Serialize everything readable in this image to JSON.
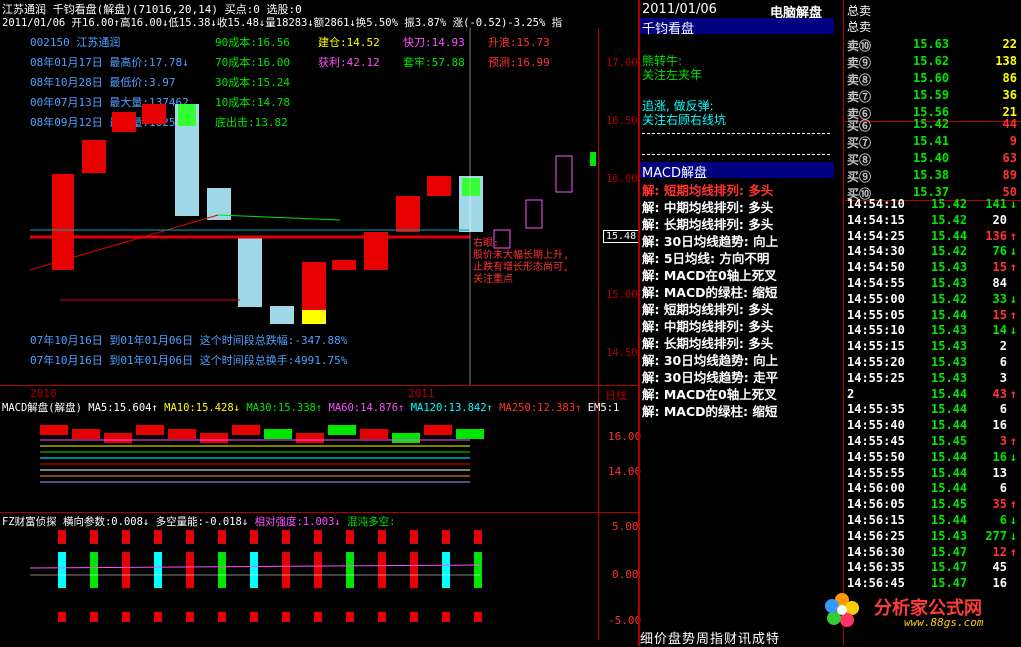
{
  "header": {
    "stock": "江苏通润",
    "title": "千钧看盘(解盘)(71016,20,14)",
    "buy": "买点:0",
    "pick": "选股:0",
    "quote": "2011/01/06 开16.00↑高16.00↓低15.38↓收15.48↓量18283↓额2861↓换5.50% 振3.87% 涨(-0.52)-3.25% 指"
  },
  "info_lines": [
    {
      "a": "002150 江苏通润",
      "b": "90成本:16.56",
      "c": "建仓:14.52",
      "d": "快刀:14.93",
      "e": "升浪:15.73"
    },
    {
      "a": "08年01月17日 最高价:17.78↓",
      "b": "70成本:16.00",
      "c": "获利:42.12",
      "d": "套牢:57.88",
      "e": "预测:16.99"
    },
    {
      "a": "08年10月28日 最低价:3.97",
      "b": "30成本:15.24"
    },
    {
      "a": "00年07月13日 最大量:137462",
      "b": "10成本:14.78"
    },
    {
      "a": "08年09月12日 最低量:1825",
      "b": "底出击:13.82"
    }
  ],
  "stats": [
    "07年10月16日 到01年01月06日 这个时间段总跌幅:-347.88%",
    "07年10月16日 到01年01月06日 这个时间段总换手:4991.75%"
  ],
  "annotation": [
    "右眼:",
    "股价未大幅长期上升,",
    "止跌有增长形态尚可,",
    "关注重点"
  ],
  "price_axis": [
    "17.00",
    "16.50",
    "16.00",
    "15.50",
    "15.00",
    "14.50"
  ],
  "current_price": "15.48",
  "date_axis": [
    "2010",
    "2011"
  ],
  "period": "日线",
  "macd_title": "MACD解盘(解盘)",
  "ma_labels": [
    "MA5:15.604↑",
    "MA10:15.428↓",
    "MA30:15.338↑",
    "MA60:14.876↑",
    "MA120:13.842↑",
    "MA250:12.383↑",
    "EM5:1"
  ],
  "macd_axis": [
    "16.00",
    "14.00"
  ],
  "fz_title": "FZ财富侦探",
  "fz_params": [
    "横向参数:0.008↓",
    "多空量能:-0.018↓",
    "相对强度:1.003↓",
    "混沌多空:"
  ],
  "fz_axis": [
    "5.00",
    "0.00",
    "-5.00"
  ],
  "panel": {
    "date": "2011/01/06",
    "title": "电脑解盘",
    "kanpan": "千钧看盘",
    "bull": "熊转牛:",
    "bull_tip": "关注左夹年",
    "chase": "追涨, 做反弹:",
    "chase_tip": "关注右顾右线坑",
    "macd": "MACD解盘",
    "items": [
      "解: 短期均线排列: 多头",
      "解: 中期均线排列: 多头",
      "解: 长期均线排列: 多头",
      "解: 30日均线趋势: 向上",
      "解: 5日均线: 方向不明",
      "解: MACD在0轴上死叉",
      "解: MACD的绿柱: 缩短",
      "解: 短期均线排列: 多头",
      "解: 中期均线排列: 多头",
      "解: 长期均线排列: 多头",
      "解: 30日均线趋势: 向上",
      "解: 30日均线趋势: 走平",
      "解: MACD在0轴上死叉",
      "解: MACD的绿柱: 缩短"
    ],
    "tabs": "细价盘势周指财讯成特"
  },
  "orders": {
    "total": "总卖",
    "sells": [
      [
        "卖⑩",
        "15.63",
        "22"
      ],
      [
        "卖⑨",
        "15.62",
        "138"
      ],
      [
        "卖⑧",
        "15.60",
        "86"
      ],
      [
        "卖⑦",
        "15.59",
        "36"
      ],
      [
        "卖⑥",
        "15.56",
        "21"
      ]
    ],
    "buys": [
      [
        "买⑥",
        "15.42",
        "44"
      ],
      [
        "买⑦",
        "15.41",
        "9"
      ],
      [
        "买⑧",
        "15.40",
        "63"
      ],
      [
        "买⑨",
        "15.38",
        "89"
      ],
      [
        "买⑩",
        "15.37",
        "50"
      ]
    ]
  },
  "ticks": [
    [
      "14:54:10",
      "15.42",
      "141",
      "↓"
    ],
    [
      "14:54:15",
      "15.42",
      "20",
      ""
    ],
    [
      "14:54:25",
      "15.44",
      "136",
      "↑"
    ],
    [
      "14:54:30",
      "15.42",
      "76",
      "↓"
    ],
    [
      "14:54:50",
      "15.43",
      "15",
      "↑"
    ],
    [
      "14:54:55",
      "15.43",
      "84",
      ""
    ],
    [
      "14:55:00",
      "15.42",
      "33",
      "↓"
    ],
    [
      "14:55:05",
      "15.44",
      "15",
      "↑"
    ],
    [
      "14:55:10",
      "15.43",
      "14",
      "↓"
    ],
    [
      "14:55:15",
      "15.43",
      "2",
      ""
    ],
    [
      "14:55:20",
      "15.43",
      "6",
      ""
    ],
    [
      "14:55:25",
      "15.43",
      "3",
      ""
    ],
    [
      "2",
      "15.44",
      "43",
      "↑"
    ],
    [
      "14:55:35",
      "15.44",
      "6",
      ""
    ],
    [
      "14:55:40",
      "15.44",
      "16",
      ""
    ],
    [
      "14:55:45",
      "15.45",
      "3",
      "↑"
    ],
    [
      "14:55:50",
      "15.44",
      "16",
      "↓"
    ],
    [
      "14:55:55",
      "15.44",
      "13",
      ""
    ],
    [
      "14:56:00",
      "15.44",
      "6",
      ""
    ],
    [
      "14:56:05",
      "15.45",
      "35",
      "↑"
    ],
    [
      "14:56:15",
      "15.44",
      "6",
      "↓"
    ],
    [
      "14:56:25",
      "15.43",
      "277",
      "↓"
    ],
    [
      "14:56:30",
      "15.47",
      "12",
      "↑"
    ],
    [
      "14:56:35",
      "15.47",
      "45",
      ""
    ],
    [
      "14:56:45",
      "15.47",
      "16",
      ""
    ]
  ],
  "watermark": {
    "name": "分析家公式网",
    "url": "www.88gs.com"
  }
}
